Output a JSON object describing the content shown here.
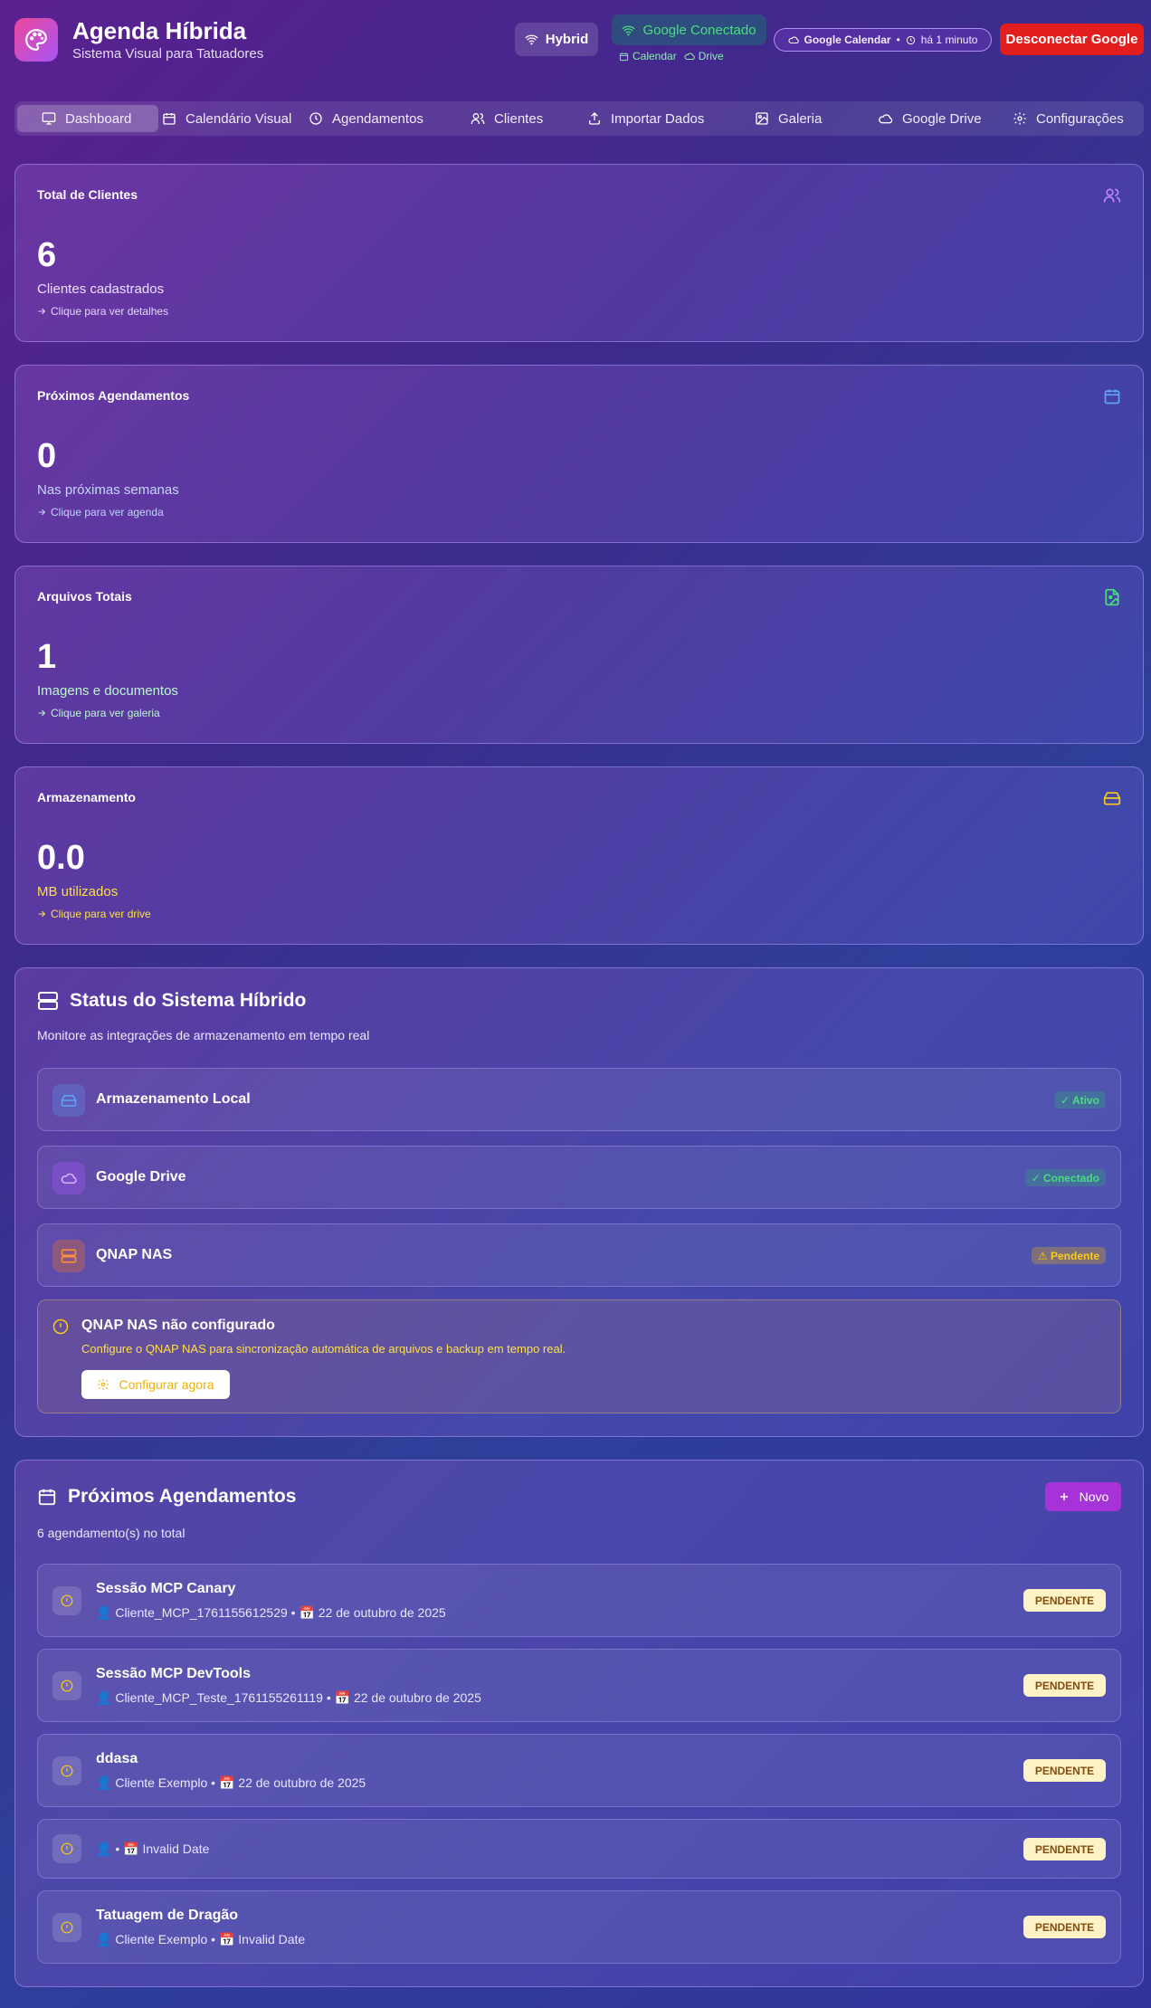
{
  "header": {
    "title": "Agenda Híbrida",
    "subtitle": "Sistema Visual para Tatuadores",
    "mode": "Hybrid",
    "google_status": "Google Conectado",
    "google_services": [
      "Calendar",
      "Drive"
    ],
    "calendar_sync": {
      "label": "Google Calendar",
      "time": "há 1 minuto"
    },
    "disconnect_label": "Desconectar Google"
  },
  "nav": {
    "items": [
      {
        "label": "Dashboard",
        "icon": "monitor-icon",
        "active": true
      },
      {
        "label": "Calendário Visual",
        "icon": "calendar-icon"
      },
      {
        "label": "Agendamentos",
        "icon": "clock-icon"
      },
      {
        "label": "Clientes",
        "icon": "users-icon"
      },
      {
        "label": "Importar Dados",
        "icon": "upload-icon"
      },
      {
        "label": "Galeria",
        "icon": "image-icon"
      },
      {
        "label": "Google Drive",
        "icon": "cloud-icon"
      },
      {
        "label": "Configurações",
        "icon": "gear-icon"
      }
    ]
  },
  "stats": [
    {
      "title": "Total de Clientes",
      "value": "6",
      "desc": "Clientes cadastrados",
      "link": "Clique para ver detalhes",
      "icon": "users-icon",
      "color": "#c084fc"
    },
    {
      "title": "Próximos Agendamentos",
      "value": "0",
      "desc": "Nas próximas semanas",
      "link": "Clique para ver agenda",
      "icon": "calendar-icon",
      "color": "#93c5fd"
    },
    {
      "title": "Arquivos Totais",
      "value": "1",
      "desc": "Imagens e documentos",
      "link": "Clique para ver galeria",
      "icon": "file-image-icon",
      "color": "#4ade80"
    },
    {
      "title": "Armazenamento",
      "value": "0.0",
      "desc": "MB utilizados",
      "link": "Clique para ver drive",
      "icon": "hard-drive-icon",
      "color": "#facc15"
    }
  ],
  "system_status": {
    "title": "Status do Sistema Híbrido",
    "subtitle": "Monitore as integrações de armazenamento em tempo real",
    "integrations": [
      {
        "name": "Armazenamento Local",
        "status": "✓ Ativo",
        "icon": "hard-drive-icon"
      },
      {
        "name": "Google Drive",
        "status": "✓ Conectado",
        "icon": "cloud-icon"
      },
      {
        "name": "QNAP NAS",
        "status": "⚠ Pendente",
        "icon": "server-icon"
      }
    ],
    "warning": {
      "title": "QNAP NAS não configurado",
      "text": "Configure o QNAP NAS para sincronização automática de arquivos e backup em tempo real.",
      "button": "Configurar agora"
    }
  },
  "appointments": {
    "title": "Próximos Agendamentos",
    "count_text": "6 agendamento(s) no total",
    "new_button": "Novo",
    "items": [
      {
        "title": "Sessão MCP Canary",
        "client": "Cliente_MCP_1761155612529",
        "date": "22 de outubro de 2025",
        "status": "PENDENTE"
      },
      {
        "title": "Sessão MCP DevTools",
        "client": "Cliente_MCP_Teste_1761155261119",
        "date": "22 de outubro de 2025",
        "status": "PENDENTE"
      },
      {
        "title": "ddasa",
        "client": "Cliente Exemplo",
        "date": "22 de outubro de 2025",
        "status": "PENDENTE"
      },
      {
        "title": "",
        "client": "",
        "date": "Invalid Date",
        "status": "PENDENTE"
      },
      {
        "title": "Tatuagem de Dragão",
        "client": "Cliente Exemplo",
        "date": "Invalid Date",
        "status": "PENDENTE"
      }
    ]
  }
}
